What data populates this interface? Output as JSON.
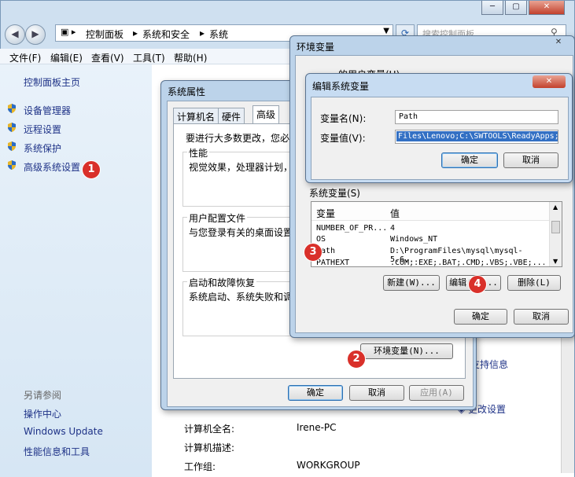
{
  "window": {
    "title_buttons": {
      "minimize": "─",
      "maximize": "▢",
      "close": "✕"
    },
    "breadcrumb": [
      "控制面板",
      "系统和安全",
      "系统"
    ],
    "search_placeholder": "搜索控制面板",
    "menu": [
      "文件(F)",
      "编辑(E)",
      "查看(V)",
      "工具(T)",
      "帮助(H)"
    ]
  },
  "sidebar": {
    "home": "控制面板主页",
    "items": [
      "设备管理器",
      "远程设置",
      "系统保护",
      "高级系统设置"
    ],
    "see_also_title": "另请参阅",
    "see_also": [
      "操作中心",
      "Windows Update",
      "性能信息和工具"
    ]
  },
  "content": {
    "right_link_1": "支持信息",
    "right_link_2": "更改设置",
    "info_rows": [
      {
        "label": "计算机全名:",
        "value": "Irene-PC"
      },
      {
        "label": "计算机描述:",
        "value": ""
      },
      {
        "label": "工作组:",
        "value": "WORKGROUP"
      }
    ]
  },
  "sysprops": {
    "title": "系统属性",
    "tabs": [
      "计算机名",
      "硬件",
      "高级"
    ],
    "intro": "要进行大多数更改，您必须",
    "groups": [
      {
        "title": "性能",
        "desc": "视觉效果，处理器计划，"
      },
      {
        "title": "用户配置文件",
        "desc": "与您登录有关的桌面设置"
      },
      {
        "title": "启动和故障恢复",
        "desc": "系统启动、系统失败和调"
      }
    ],
    "env_button": "环境变量(N)...",
    "ok": "确定",
    "cancel": "取消",
    "apply": "应用(A)"
  },
  "envvars": {
    "title": "环境变量",
    "user_vars_label": "的用户变量(U)",
    "sys_vars_label": "系统变量(S)",
    "columns": [
      "变量",
      "值"
    ],
    "rows": [
      {
        "name": "NUMBER_OF_PR...",
        "value": "4"
      },
      {
        "name": "OS",
        "value": "Windows_NT"
      },
      {
        "name": "Path",
        "value": "D:\\ProgramFiles\\mysql\\mysql-5.6..."
      },
      {
        "name": "PATHEXT",
        "value": ".COM;.EXE;.BAT;.CMD;.VBS;.VBE;..."
      }
    ],
    "new_button": "新建(W)...",
    "edit_button": "编辑(I)...",
    "delete_button": "删除(L)",
    "ok": "确定",
    "cancel": "取消"
  },
  "editvar": {
    "title": "编辑系统变量",
    "name_label": "变量名(N):",
    "value_label": "变量值(V):",
    "name_value": "Path",
    "value_value": "Files\\Lenovo;C:\\SWTOOLS\\ReadyApps;",
    "ok": "确定",
    "cancel": "取消",
    "close": "✕"
  },
  "badges": [
    "1",
    "2",
    "3",
    "4"
  ],
  "colors": {
    "badge": "#d9302a",
    "link": "#1e3287",
    "selection": "#3370c4"
  }
}
